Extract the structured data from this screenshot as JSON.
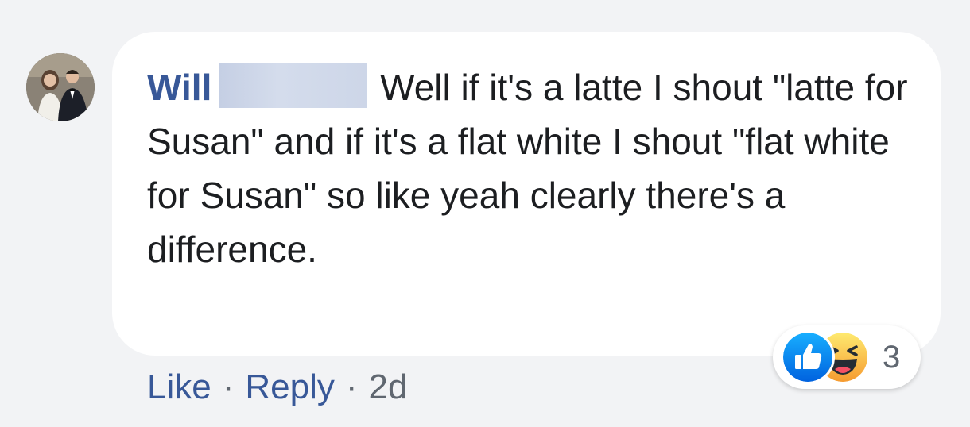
{
  "comment": {
    "author_name": "Will",
    "text": "Well if it's a latte I shout \"latte for Susan\" and if it's a flat white I shout \"flat white for Susan\" so like yeah clearly there's a difference."
  },
  "actions": {
    "like_label": "Like",
    "separator": "·",
    "reply_label": "Reply",
    "timestamp": "2d"
  },
  "reactions": {
    "icons": [
      "like-reaction-icon",
      "haha-reaction-icon"
    ],
    "count": "3"
  },
  "colors": {
    "link_blue": "#385898",
    "like_blue": "#1877f2",
    "haha_yellow": "#f7b125",
    "bubble_bg": "#ffffff",
    "page_bg": "#f2f3f5"
  }
}
